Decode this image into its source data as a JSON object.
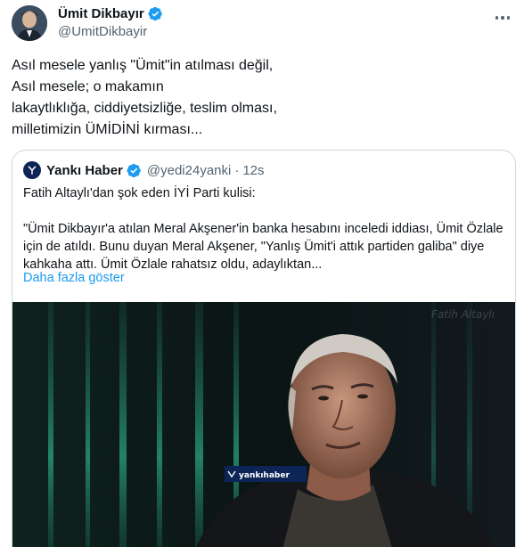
{
  "author": {
    "display_name": "Ümit Dikbayır",
    "handle": "@UmitDikbayir"
  },
  "tweet_text": "Asıl mesele yanlış \"Ümit\"in atılması değil,\nAsıl mesele; o makamın\nlakaytlıklığa, ciddiyetsizliğe,  teslim olması,\nmilletimizin ÜMİDİNİ kırması...",
  "quoted_tweet": {
    "display_name": "Yankı Haber",
    "handle": "@yedi24yanki",
    "separator": "·",
    "time": "12s",
    "line1": "Fatih Altaylı'dan şok eden İYİ Parti kulisi:",
    "line2": "\"Ümit Dikbayır'a atılan Meral Akşener'in banka hesabını inceledi iddiası, Ümit Özlale için de atıldı. Bunu duyan Meral Akşener, \"Yanlış Ümit'i attık partiden galiba\" diye kahkaha attı. Ümit Özlale rahatsız oldu, adaylıktan...",
    "show_more": "Daha fazla göster",
    "media": {
      "watermark_logo": "yankıhaber",
      "corner_watermark": "Fatih Altaylı"
    }
  },
  "colors": {
    "verified": "#1d9bf0",
    "link": "#1d9bf0",
    "muted": "#536471",
    "border": "#cfd9de"
  },
  "icons": [
    "verified-badge-icon",
    "more-options-icon"
  ]
}
